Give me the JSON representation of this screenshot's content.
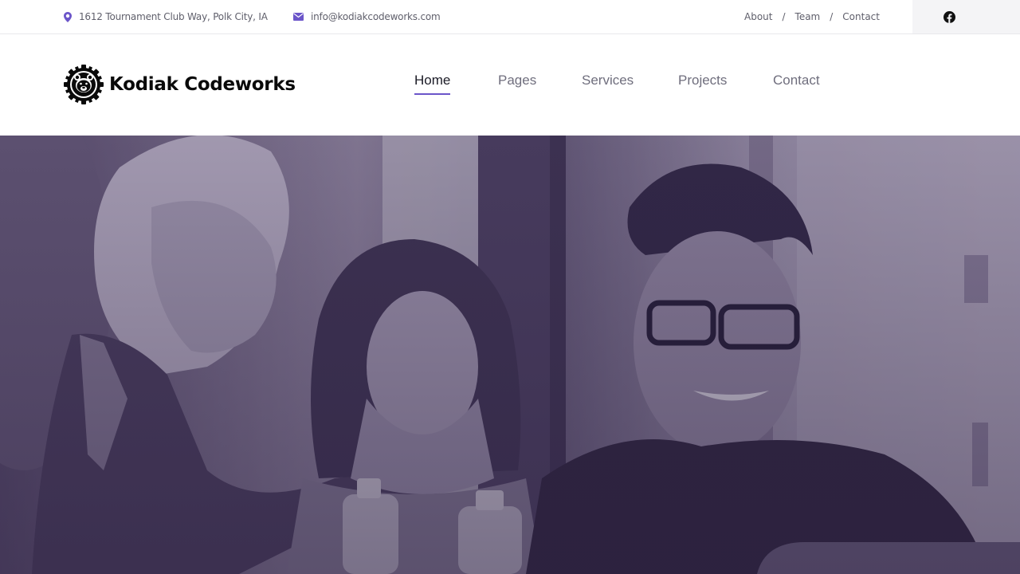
{
  "topbar": {
    "address": "1612 Tournament Club Way, Polk City, IA",
    "email": "info@kodiakcodeworks.com",
    "links": [
      {
        "label": "About"
      },
      {
        "label": "Team"
      },
      {
        "label": "Contact"
      }
    ],
    "separator": "/",
    "social": {
      "icon": "facebook-icon"
    }
  },
  "brand": {
    "name": "Kodiak Codeworks",
    "logo_icon": "bear-gear-logo"
  },
  "nav": {
    "items": [
      {
        "label": "Home",
        "active": true
      },
      {
        "label": "Pages",
        "active": false
      },
      {
        "label": "Services",
        "active": false
      },
      {
        "label": "Projects",
        "active": false
      },
      {
        "label": "Contact",
        "active": false
      }
    ]
  },
  "hero": {
    "image": "team-photo-purple-overlay"
  },
  "colors": {
    "accent": "#6b55c9",
    "text": "#5f5f6b",
    "nav_text": "#6f6e7d",
    "nav_active": "#1b1b26",
    "hero_overlay": "#3a2d55"
  }
}
